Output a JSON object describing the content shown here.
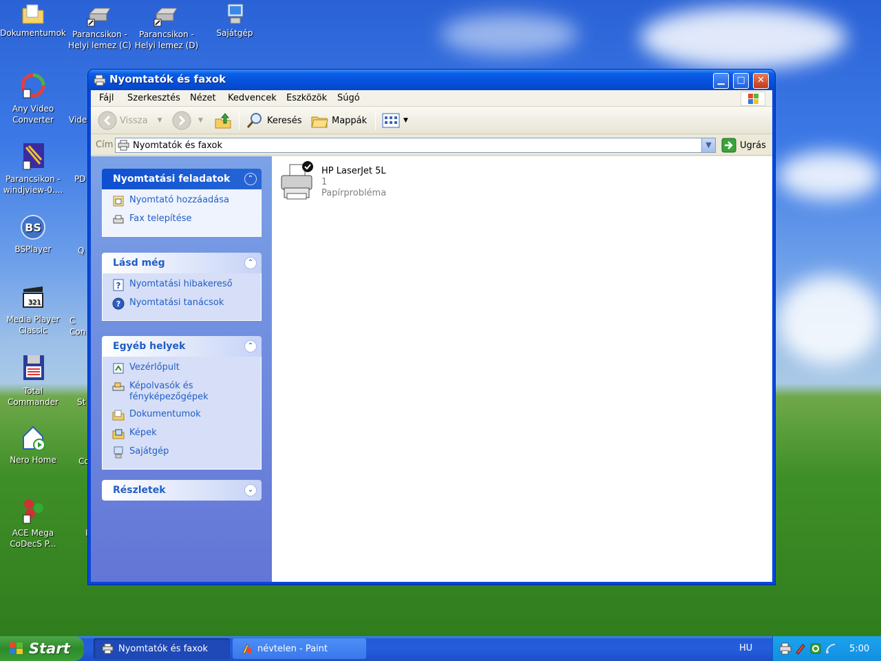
{
  "desktop": {
    "icons": [
      {
        "label": "Dokumentumok"
      },
      {
        "label": "Parancsikon - Helyi lemez (C)"
      },
      {
        "label": "Parancsikon - Helyi lemez (D)"
      },
      {
        "label": "Sajátgép"
      },
      {
        "label": "Any Video Converter"
      },
      {
        "label": "Vide"
      },
      {
        "label": "Parancsikon - windjview-0...."
      },
      {
        "label": "PD"
      },
      {
        "label": "BSPlayer"
      },
      {
        "label": "Q"
      },
      {
        "label": "Media Player Classic"
      },
      {
        "label": "C Con"
      },
      {
        "label": "Total Commander"
      },
      {
        "label": "St"
      },
      {
        "label": "Nero Home"
      },
      {
        "label": "Co"
      },
      {
        "label": "ACE Mega CoDecS P..."
      },
      {
        "label": "I"
      }
    ]
  },
  "window": {
    "title": "Nyomtatók és faxok",
    "menu": [
      "Fájl",
      "Szerkesztés",
      "Nézet",
      "Kedvencek",
      "Eszközök",
      "Súgó"
    ],
    "toolbar": {
      "back": "Vissza",
      "search": "Keresés",
      "folders": "Mappák"
    },
    "address": {
      "label": "Cím",
      "value": "Nyomtatók és faxok",
      "go": "Ugrás"
    },
    "taskpane": {
      "tasks": {
        "title": "Nyomtatási feladatok",
        "links": [
          "Nyomtató hozzáadása",
          "Fax telepítése"
        ]
      },
      "seealso": {
        "title": "Lásd még",
        "links": [
          "Nyomtatási hibakereső",
          "Nyomtatási tanácsok"
        ]
      },
      "other": {
        "title": "Egyéb helyek",
        "links": [
          "Vezérlőpult",
          "Képolvasók és fényképezőgépek",
          "Dokumentumok",
          "Képek",
          "Sajátgép"
        ]
      },
      "details": {
        "title": "Részletek"
      }
    },
    "printers": [
      {
        "name": "HP LaserJet 5L",
        "jobs": "1",
        "status": "Papírprobléma"
      }
    ]
  },
  "taskbar": {
    "start": "Start",
    "tasks": [
      {
        "label": "Nyomtatók és faxok"
      },
      {
        "label": "névtelen - Paint"
      }
    ],
    "language": "HU",
    "clock": "5:00"
  },
  "colors": {
    "title_blue": "#0a5ee6",
    "taskpane_link": "#215dc6",
    "start_green": "#2d8a2a",
    "tray_blue": "#138fe0"
  }
}
